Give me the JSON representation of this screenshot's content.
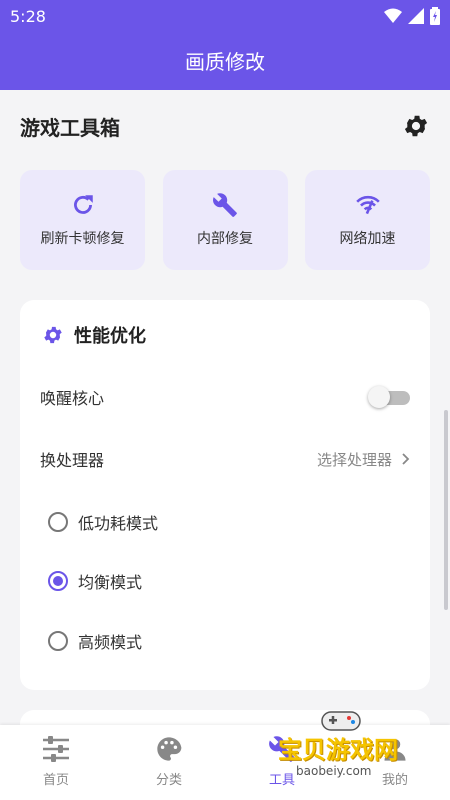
{
  "status_bar": {
    "time": "5:28"
  },
  "app_bar": {
    "title": "画质修改"
  },
  "toolbox": {
    "title": "游戏工具箱"
  },
  "quick_tiles": [
    {
      "label": "刷新卡顿修复",
      "icon": "refresh-icon"
    },
    {
      "label": "内部修复",
      "icon": "wrench-icon"
    },
    {
      "label": "网络加速",
      "icon": "wifi-icon"
    }
  ],
  "performance": {
    "title": "性能优化",
    "wake_core_label": "唤醒核心",
    "wake_core_on": false,
    "processor_label": "换处理器",
    "processor_value": "选择处理器",
    "modes": [
      {
        "label": "低功耗模式",
        "selected": false
      },
      {
        "label": "均衡模式",
        "selected": true
      },
      {
        "label": "高频模式",
        "selected": false
      }
    ]
  },
  "bottom_nav": [
    {
      "label": "首页",
      "icon": "sliders-icon",
      "active": false
    },
    {
      "label": "分类",
      "icon": "palette-icon",
      "active": false
    },
    {
      "label": "工具",
      "icon": "tools-icon",
      "active": true
    },
    {
      "label": "我的",
      "icon": "person-icon",
      "active": false
    }
  ],
  "watermark": {
    "text": "宝贝游戏网",
    "url": "baobeiy.com"
  },
  "colors": {
    "primary": "#6b55e8",
    "tile_bg": "#ece9fb",
    "background": "#f4f4f6"
  }
}
